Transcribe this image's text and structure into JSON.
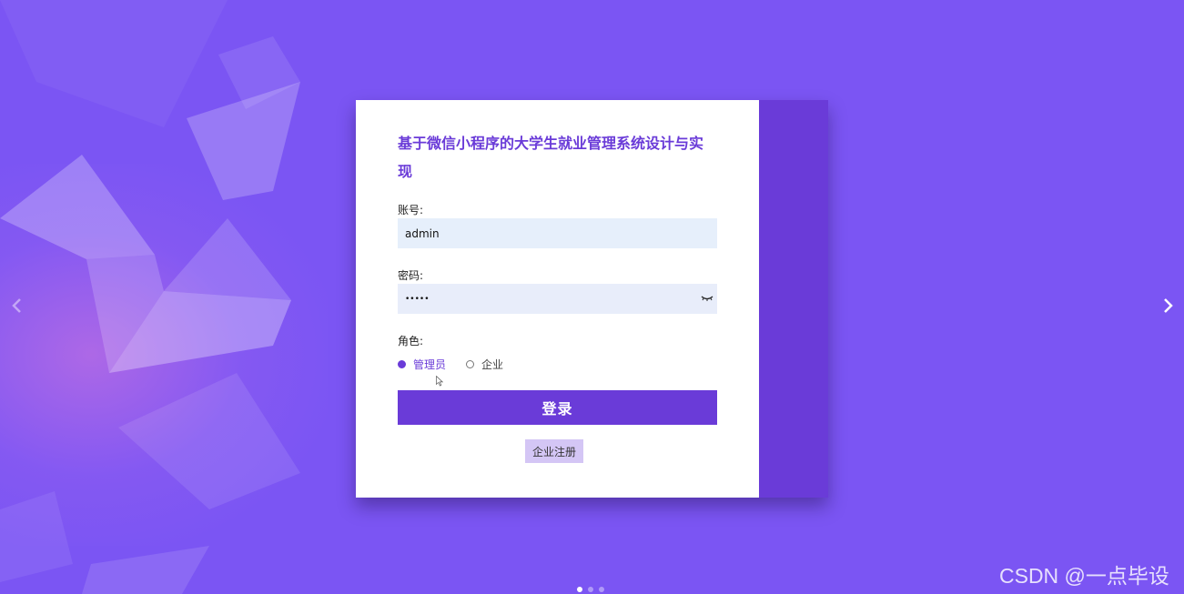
{
  "login": {
    "title": "基于微信小程序的大学生就业管理系统设计与实现",
    "account_label": "账号:",
    "account_value": "admin",
    "password_label": "密码:",
    "password_value": "•••••",
    "role_label": "角色:",
    "roles": [
      {
        "label": "管理员",
        "checked": true
      },
      {
        "label": "企业",
        "checked": false
      }
    ],
    "login_button": "登录",
    "register_button": "企业注册"
  },
  "carousel": {
    "prev_icon": "chevron-left-icon",
    "next_icon": "chevron-right-icon",
    "slide_count": 3,
    "active_index": 0
  },
  "watermark": "CSDN @一点毕设",
  "colors": {
    "background": "#7b55f3",
    "accent": "#6a3bd8",
    "input_bg": "#e6effb",
    "register_bg": "#d4c6f5"
  }
}
